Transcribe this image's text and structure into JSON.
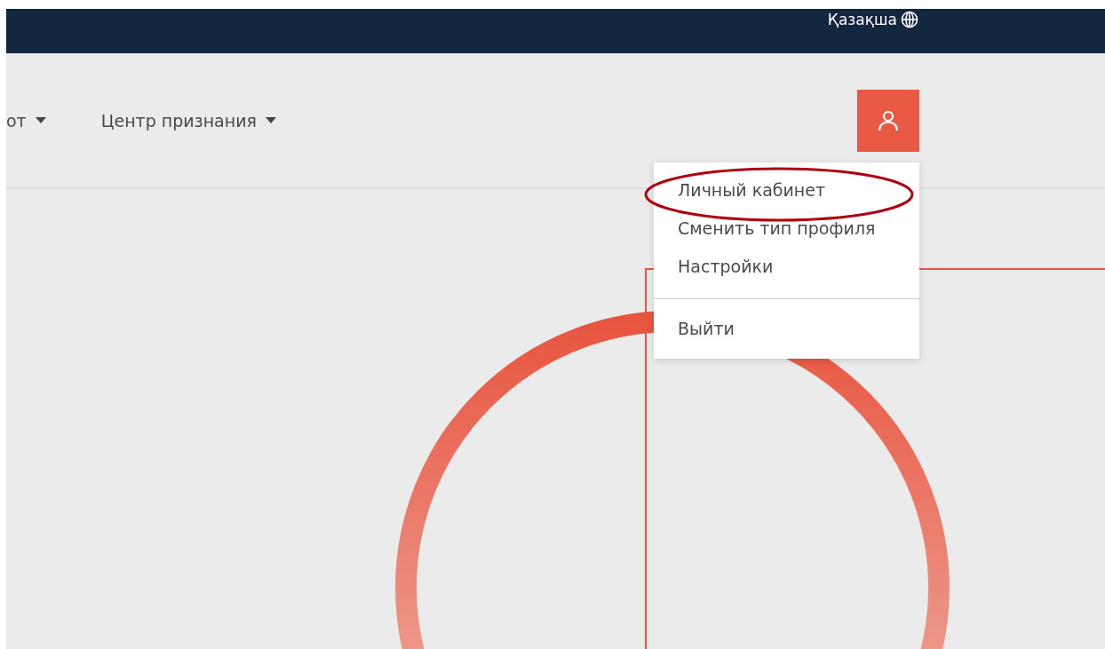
{
  "top_bar": {
    "language": "Қазақша"
  },
  "nav": [
    {
      "label": "от"
    },
    {
      "label": "Центр признания"
    }
  ],
  "profile_menu": {
    "items": [
      {
        "kind": "link",
        "label": "Личный кабинет",
        "highlighted": true
      },
      {
        "kind": "link",
        "label": "Сменить тип профиля",
        "highlighted": false
      },
      {
        "kind": "link",
        "label": "Настройки",
        "highlighted": false
      },
      {
        "kind": "divider"
      },
      {
        "kind": "link",
        "label": "Выйти",
        "highlighted": false
      }
    ]
  }
}
